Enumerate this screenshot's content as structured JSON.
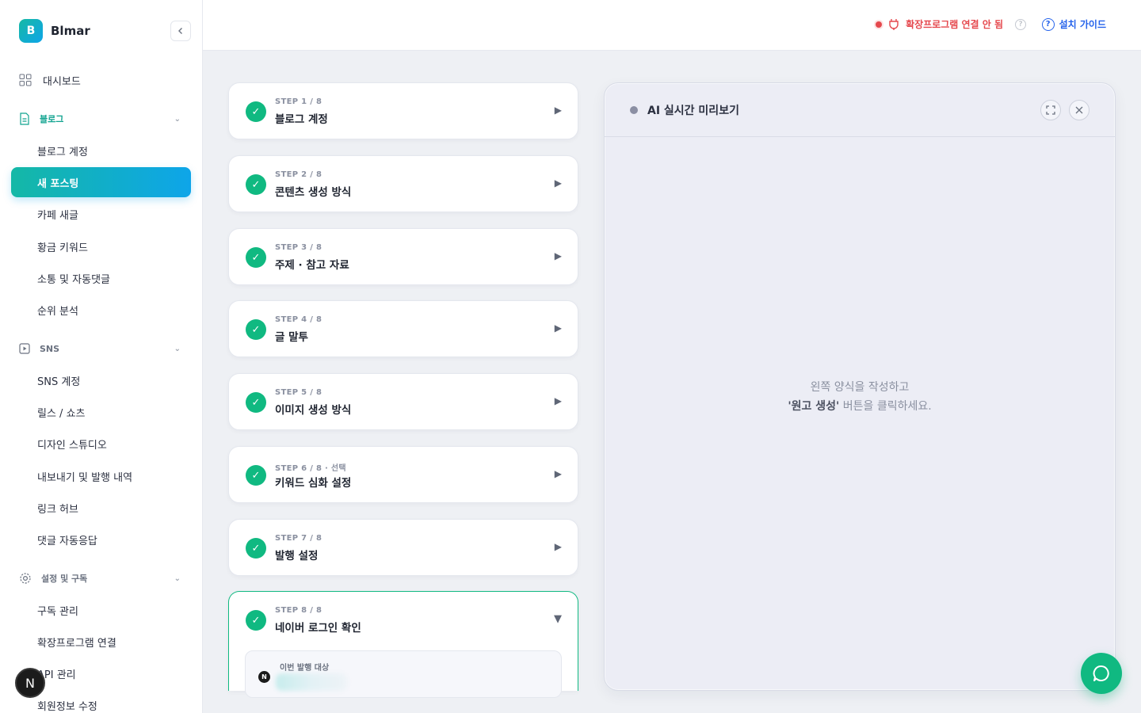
{
  "brand": {
    "logo_letter": "B",
    "name": "Blmar"
  },
  "sidebar": {
    "dashboard": "대시보드",
    "sections": [
      {
        "label": "블로그",
        "items": [
          "블로그 계정",
          "새 포스팅",
          "카페 새글",
          "황금 키워드",
          "소통 및 자동댓글",
          "순위 분석"
        ]
      },
      {
        "label": "SNS",
        "items": [
          "SNS 계정",
          "릴스 / 쇼츠",
          "디자인 스튜디오",
          "내보내기 및 발행 내역",
          "링크 허브",
          "댓글 자동응답"
        ]
      },
      {
        "label": "설정 및 구독",
        "items": [
          "구독 관리",
          "확장프로그램 연결",
          "API 관리",
          "회원정보 수정"
        ]
      }
    ],
    "active_item": "새 포스팅",
    "avatar_letter": "N"
  },
  "topbar": {
    "extension_status": "확장프로그램 연결 안 됨",
    "help_mark": "?",
    "guide_label": "설치 가이드"
  },
  "steps": [
    {
      "num": "STEP 1 / 8",
      "title": "블로그 계정"
    },
    {
      "num": "STEP 2 / 8",
      "title": "콘텐츠 생성 방식"
    },
    {
      "num": "STEP 3 / 8",
      "title": "주제 · 참고 자료"
    },
    {
      "num": "STEP 4 / 8",
      "title": "글 말투"
    },
    {
      "num": "STEP 5 / 8",
      "title": "이미지 생성 방식"
    },
    {
      "num": "STEP 6 / 8 · 선택",
      "title": "키워드 심화 설정"
    },
    {
      "num": "STEP 7 / 8",
      "title": "발행 설정"
    },
    {
      "num": "STEP 8 / 8",
      "title": "네이버 로그인 확인"
    }
  ],
  "step8": {
    "target_label": "이번 발행 대상",
    "badge": "N"
  },
  "preview": {
    "title": "AI 실시간 미리보기",
    "msg_line1": "왼쪽 양식을 작성하고",
    "msg_bold": "'원고 생성'",
    "msg_rest": " 버튼을 클릭하세요."
  },
  "colors": {
    "accent": "#10b981",
    "brand_gradient_end": "#0ea5e9",
    "error": "#e5484d",
    "link": "#2563eb"
  }
}
